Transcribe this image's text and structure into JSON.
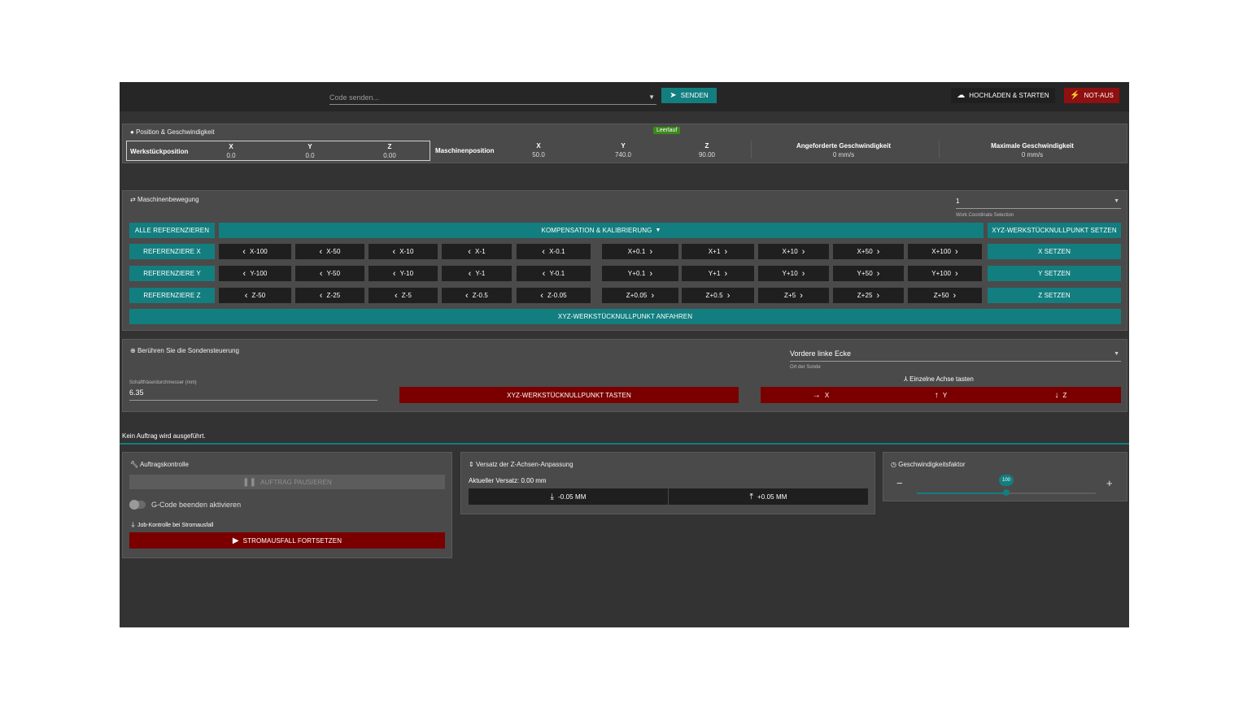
{
  "topbar": {
    "code_placeholder": "Code senden...",
    "send_label": "SENDEN",
    "upload_label": "HOCHLADEN & STARTEN",
    "estop_label": "NOT-AUS"
  },
  "position": {
    "title": "Position & Geschwindigkeit",
    "status": "Leerlauf",
    "work_label": "Werkstückposition",
    "machine_label": "Maschinenposition",
    "axes": [
      "X",
      "Y",
      "Z"
    ],
    "work_values": [
      "0.0",
      "0.0",
      "0.00"
    ],
    "machine_values": [
      "50.0",
      "740.0",
      "90.00"
    ],
    "requested_speed_label": "Angeforderte Geschwindigkeit",
    "requested_speed_value": "0 mm/s",
    "max_speed_label": "Maximale Geschwindigkeit",
    "max_speed_value": "0 mm/s"
  },
  "movement": {
    "title": "Maschinenbewegung",
    "wcs_value": "1",
    "wcs_caption": "Work Coordinate Selection",
    "home_all": "ALLE REFERENZIEREN",
    "compensation": "KOMPENSATION & KALIBRIERUNG",
    "set_xyz_zero": "XYZ-WERKSTÜCKNULLPUNKT SETZEN",
    "rows": [
      {
        "home": "REFERENZIERE X",
        "neg": [
          "X-100",
          "X-50",
          "X-10",
          "X-1",
          "X-0.1"
        ],
        "pos": [
          "X+0.1",
          "X+1",
          "X+10",
          "X+50",
          "X+100"
        ],
        "set": "X SETZEN"
      },
      {
        "home": "REFERENZIERE Y",
        "neg": [
          "Y-100",
          "Y-50",
          "Y-10",
          "Y-1",
          "Y-0.1"
        ],
        "pos": [
          "Y+0.1",
          "Y+1",
          "Y+10",
          "Y+50",
          "Y+100"
        ],
        "set": "Y SETZEN"
      },
      {
        "home": "REFERENZIERE Z",
        "neg": [
          "Z-50",
          "Z-25",
          "Z-5",
          "Z-0.5",
          "Z-0.05"
        ],
        "pos": [
          "Z+0.05",
          "Z+0.5",
          "Z+5",
          "Z+25",
          "Z+50"
        ],
        "set": "Z SETZEN"
      }
    ],
    "goto_zero": "XYZ-WERKSTÜCKNULLPUNKT ANFAHREN"
  },
  "probe": {
    "title": "Berühren Sie die Sondensteuerung",
    "location_value": "Vordere linke Ecke",
    "location_caption": "Ort der Sonde",
    "diameter_label": "Schaftfräserdurchmesser (mm)",
    "diameter_value": "6.35",
    "probe_xyz": "XYZ-WERKSTÜCKNULLPUNKT TASTEN",
    "single_axis_label": "Einzelne Achse tasten",
    "axis_x": "X",
    "axis_y": "Y",
    "axis_z": "Z"
  },
  "job_status": "Kein Auftrag wird ausgeführt.",
  "job_control": {
    "title": "Auftragskontrolle",
    "pause": "AUFTRAG PAUSIEREN",
    "gcode_toggle_label": "G-Code beenden aktivieren",
    "power_loss_label": "Job-Kontrolle bei Stromausfall",
    "resume_power": "STROMAUSFALL FORTSETZEN"
  },
  "z_offset": {
    "title": "Versatz der Z-Achsen-Anpassung",
    "current_label": "Aktueller Versatz: 0.00 mm",
    "minus": "-0.05 MM",
    "plus": "+0.05 MM"
  },
  "speed_factor": {
    "title": "Geschwindigkeitsfaktor",
    "value": "100",
    "fraction": 0.5,
    "minus": "−",
    "plus": "+"
  },
  "colors": {
    "accent": "#137e7f",
    "danger": "#7a0000",
    "status_green": "#3b8a1c"
  }
}
